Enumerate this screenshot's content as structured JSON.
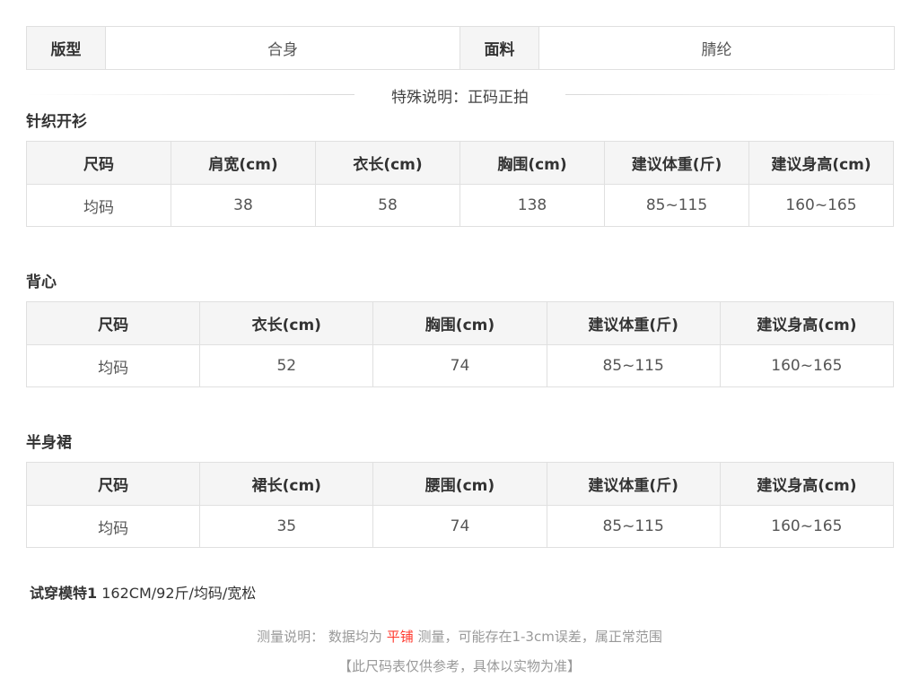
{
  "attributes": {
    "fit_label": "版型",
    "fit_value": "合身",
    "fabric_label": "面料",
    "fabric_value": "腈纶"
  },
  "special_note": "特殊说明：正码正拍",
  "cardigan": {
    "title": "针织开衫",
    "headers": [
      "尺码",
      "肩宽(cm)",
      "衣长(cm)",
      "胸围(cm)",
      "建议体重(斤)",
      "建议身高(cm)"
    ],
    "row": [
      "均码",
      "38",
      "58",
      "138",
      "85~115",
      "160~165"
    ]
  },
  "vest": {
    "title": "背心",
    "headers": [
      "尺码",
      "衣长(cm)",
      "胸围(cm)",
      "建议体重(斤)",
      "建议身高(cm)"
    ],
    "row": [
      "均码",
      "52",
      "74",
      "85~115",
      "160~165"
    ]
  },
  "skirt": {
    "title": "半身裙",
    "headers": [
      "尺码",
      "裙长(cm)",
      "腰围(cm)",
      "建议体重(斤)",
      "建议身高(cm)"
    ],
    "row": [
      "均码",
      "35",
      "74",
      "85~115",
      "160~165"
    ]
  },
  "model": {
    "label": "试穿模特1",
    "info": " 162CM/92斤/均码/宽松"
  },
  "measure_note": {
    "prefix": "测量说明：  数据均为 ",
    "highlight": "平铺",
    "suffix": " 测量，可能存在1-3cm误差，属正常范围"
  },
  "disclaimer": "【此尺码表仅供参考，具体以实物为准】",
  "colors": {
    "header_bg": "#f5f5f5",
    "border": "#e0e0e0",
    "highlight": "#ff3b30",
    "muted_text": "#999999"
  }
}
